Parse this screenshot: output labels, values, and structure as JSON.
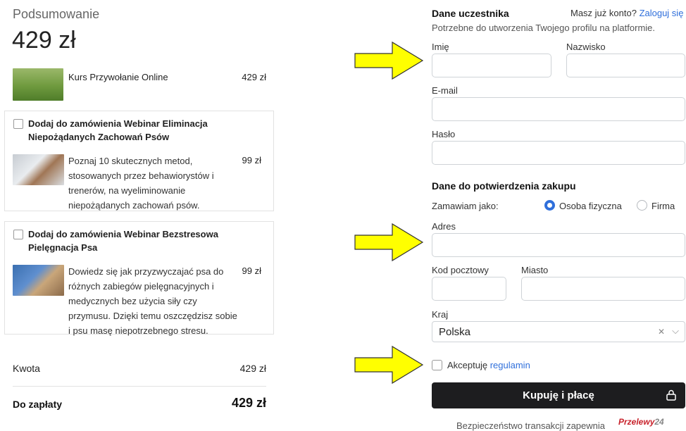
{
  "summary": {
    "heading": "Podsumowanie",
    "total": "429 zł",
    "product": {
      "name": "Kurs Przywołanie Online",
      "price": "429 zł"
    },
    "upsells": [
      {
        "title": "Dodaj do zamówienia Webinar Eliminacja Niepożądanych Zachowań Psów",
        "description": "Poznaj 10 skutecznych metod, stosowanych przez behawiorystów i trenerów, na wyeliminowanie niepożądanych zachowań psów.",
        "price": "99 zł"
      },
      {
        "title": "Dodaj do zamówienia Webinar Bezstresowa Pielęgnacja Psa",
        "description": "Dowiedz się jak przyzwyczajać psa do różnych zabiegów pielęgnacyjnych i medycznych bez użycia siły czy przymusu. Dzięki temu oszczędzisz sobie i psu masę niepotrzebnego stresu.",
        "price": "99 zł"
      }
    ],
    "amount_label": "Kwota",
    "amount_value": "429 zł",
    "pay_label": "Do zapłaty",
    "pay_value": "429 zł"
  },
  "participant": {
    "title": "Dane uczestnika",
    "login_prompt": "Masz już konto?",
    "login_link": "Zaloguj się",
    "subtitle": "Potrzebne do utworzenia Twojego profilu na platformie.",
    "first_name_label": "Imię",
    "first_name_value": "",
    "last_name_label": "Nazwisko",
    "last_name_value": "",
    "email_label": "E-mail",
    "email_value": "",
    "password_label": "Hasło",
    "password_value": ""
  },
  "purchase": {
    "title": "Dane do potwierdzenia zakupu",
    "order_as_label": "Zamawiam jako:",
    "option_person": "Osoba fizyczna",
    "option_company": "Firma",
    "selected_option": "Osoba fizyczna",
    "address_label": "Adres",
    "address_value": "",
    "postal_label": "Kod pocztowy",
    "postal_value": "",
    "city_label": "Miasto",
    "city_value": "",
    "country_label": "Kraj",
    "country_value": "Polska",
    "accept_prefix": "Akceptuję",
    "accept_link": "regulamin",
    "buy_button": "Kupuję i płacę",
    "secure_text": "Bezpieczeństwo transakcji zapewnia",
    "payment_logo_text": "Przelewy",
    "payment_logo_number": "24"
  },
  "colors": {
    "accent": "#2f6fdb",
    "button_bg": "#1d1d1f",
    "arrow_fill": "#ffff00"
  }
}
